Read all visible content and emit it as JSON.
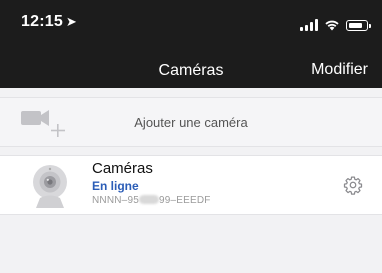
{
  "status_bar": {
    "time": "12:15",
    "location_icon": "location-arrow-icon",
    "signal_icon": "cellular-signal-icon",
    "wifi_icon": "wifi-icon",
    "battery_icon": "battery-icon"
  },
  "nav": {
    "title": "Caméras",
    "action_label": "Modifier"
  },
  "add_camera": {
    "icon": "add-camera-icon",
    "label": "Ajouter une caméra"
  },
  "cameras": [
    {
      "name": "Caméras",
      "status": "En ligne",
      "uid_prefix": "NNNN–95",
      "uid_suffix": "99–EEEDF",
      "thumbnail_icon": "webcam-icon",
      "settings_icon": "gear-icon"
    }
  ],
  "colors": {
    "topbar": "#1c1c1c",
    "online_status": "#2b5db7",
    "background": "#f2f2f4"
  }
}
